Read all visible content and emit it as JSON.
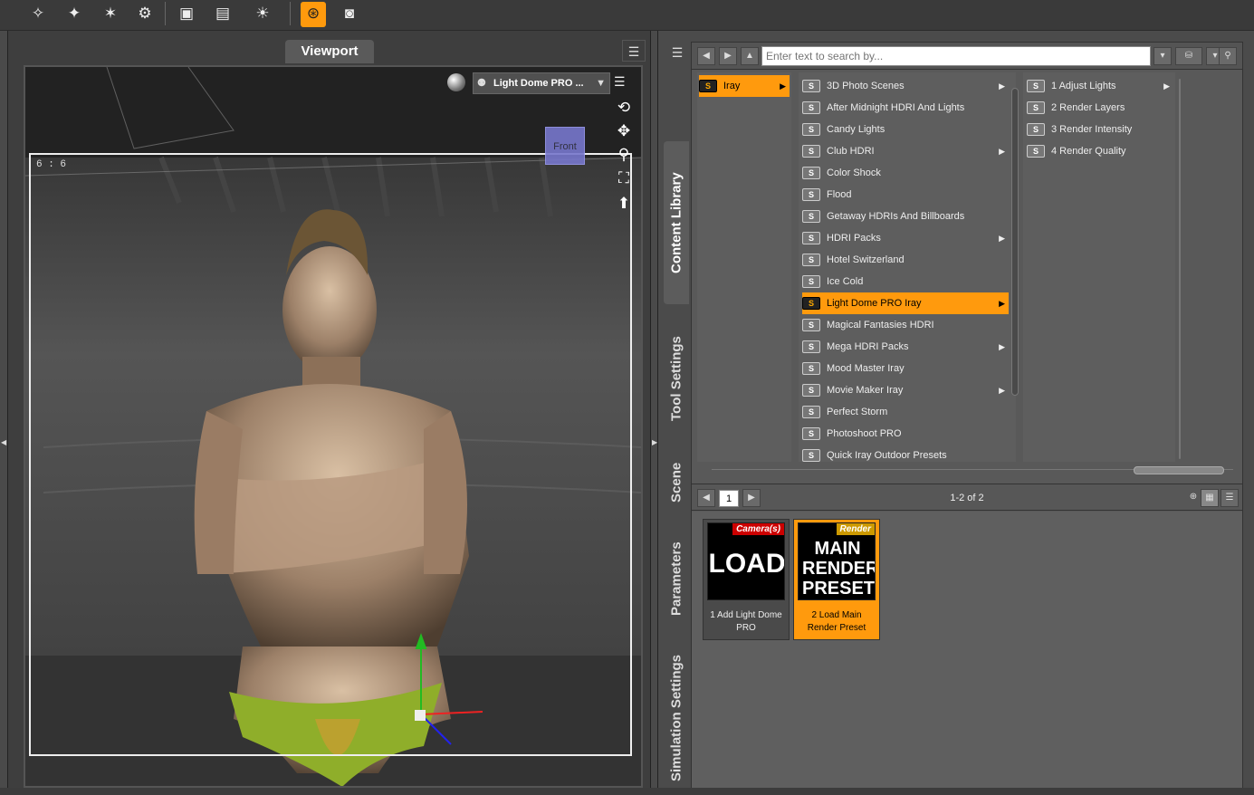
{
  "toolbar": {
    "icons": [
      "spotlight-create-icon",
      "point-light-create-icon",
      "distant-light-icon",
      "light-settings-icon",
      "scene-load-icon",
      "light-preset-icon",
      "bulb-icon",
      "render-settings-icon",
      "camera-icon"
    ]
  },
  "viewport": {
    "tab_label": "Viewport",
    "aspect_label": "6 : 6",
    "camera_label": "Light Dome PRO ...",
    "cube_label": "Front"
  },
  "side_tabs": [
    "Content Library",
    "Tool Settings",
    "Scene",
    "Parameters",
    "Simulation Settings"
  ],
  "content_library": {
    "search_placeholder": "Enter text to search by...",
    "col1": [
      {
        "label": "Iray",
        "selected": true,
        "submenu": true
      }
    ],
    "col2": [
      {
        "label": "3D Photo Scenes",
        "submenu": true
      },
      {
        "label": "After Midnight HDRI And Lights"
      },
      {
        "label": "Candy Lights"
      },
      {
        "label": "Club HDRI",
        "submenu": true
      },
      {
        "label": "Color Shock"
      },
      {
        "label": "Flood"
      },
      {
        "label": "Getaway HDRIs And Billboards"
      },
      {
        "label": "HDRI Packs",
        "submenu": true
      },
      {
        "label": "Hotel Switzerland"
      },
      {
        "label": "Ice Cold"
      },
      {
        "label": "Light Dome PRO Iray",
        "selected": true,
        "submenu": true
      },
      {
        "label": "Magical Fantasies HDRI"
      },
      {
        "label": "Mega HDRI Packs",
        "submenu": true
      },
      {
        "label": "Mood Master Iray"
      },
      {
        "label": "Movie Maker Iray",
        "submenu": true
      },
      {
        "label": "Perfect Storm"
      },
      {
        "label": "Photoshoot PRO"
      },
      {
        "label": "Quick Iray Outdoor Presets"
      }
    ],
    "col3": [
      {
        "label": "1 Adjust Lights",
        "submenu": true
      },
      {
        "label": "2 Render Layers"
      },
      {
        "label": "3 Render Intensity"
      },
      {
        "label": "4 Render Quality"
      }
    ],
    "page_number": "1",
    "page_count": "1-2 of 2",
    "thumbnails": [
      {
        "tag": "Camera(s)",
        "big_text": "LOAD",
        "caption": "1 Add Light Dome PRO",
        "selected": false
      },
      {
        "tag": "Render",
        "big_text": "MAIN RENDER PRESET",
        "caption": "2 Load Main Render Preset",
        "selected": true
      }
    ]
  },
  "colors": {
    "accent": "#ff9a0d",
    "panel": "#595959",
    "cube": "#7777cc"
  }
}
